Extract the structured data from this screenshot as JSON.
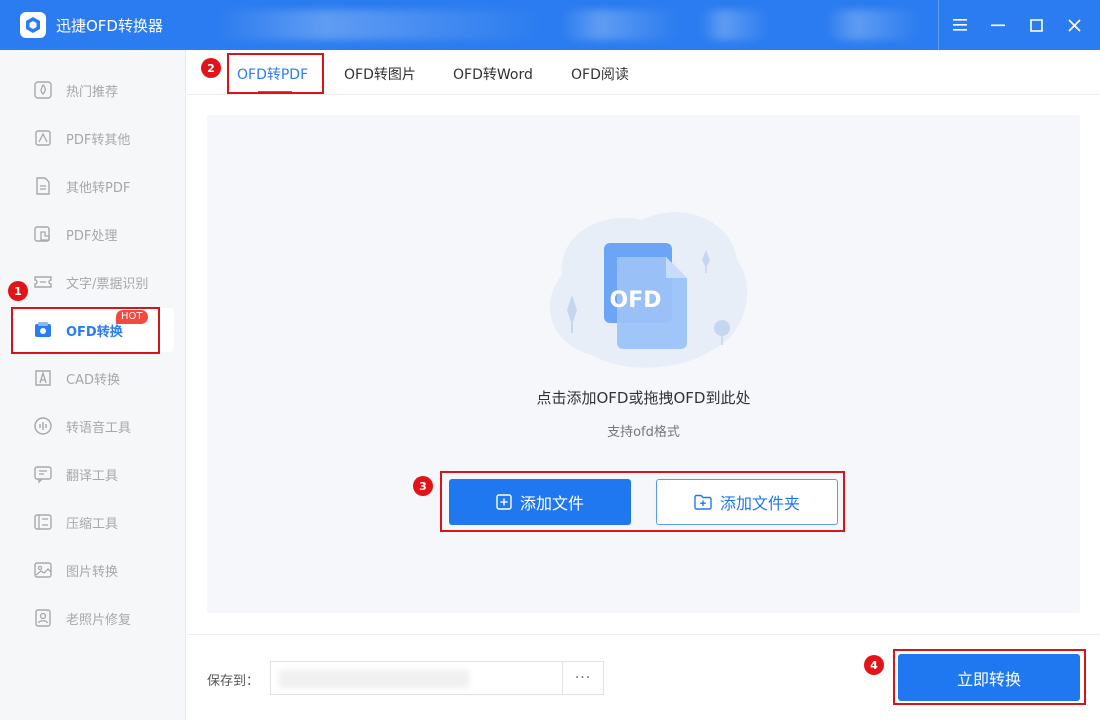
{
  "app": {
    "title": "迅捷OFD转换器"
  },
  "sidebar": {
    "items": [
      {
        "label": "热门推荐",
        "icon": "hot-recommend-icon"
      },
      {
        "label": "PDF转其他",
        "icon": "pdf-convert-icon"
      },
      {
        "label": "其他转PDF",
        "icon": "to-pdf-icon"
      },
      {
        "label": "PDF处理",
        "icon": "pdf-process-icon"
      },
      {
        "label": "文字/票据识别",
        "icon": "ocr-icon"
      },
      {
        "label": "OFD转换",
        "icon": "ofd-icon",
        "badge": "HOT",
        "active": true
      },
      {
        "label": "CAD转换",
        "icon": "cad-icon"
      },
      {
        "label": "转语音工具",
        "icon": "voice-icon"
      },
      {
        "label": "翻译工具",
        "icon": "translate-icon"
      },
      {
        "label": "压缩工具",
        "icon": "compress-icon"
      },
      {
        "label": "图片转换",
        "icon": "image-icon"
      },
      {
        "label": "老照片修复",
        "icon": "photo-restore-icon"
      }
    ]
  },
  "tabs": [
    {
      "label": "OFD转PDF",
      "active": true
    },
    {
      "label": "OFD转图片"
    },
    {
      "label": "OFD转Word"
    },
    {
      "label": "OFD阅读"
    }
  ],
  "drop": {
    "illustration_text": "OFD",
    "main_text": "点击添加OFD或拖拽OFD到此处",
    "sub_text": "支持ofd格式",
    "add_file_label": "添加文件",
    "add_folder_label": "添加文件夹"
  },
  "footer": {
    "save_label": "保存到：",
    "browse_label": "···",
    "convert_label": "立即转换"
  },
  "annotations": [
    "1",
    "2",
    "3",
    "4"
  ],
  "colors": {
    "primary": "#2b7cf0",
    "annotation": "#d7141a",
    "badge": "#f24a3e"
  }
}
